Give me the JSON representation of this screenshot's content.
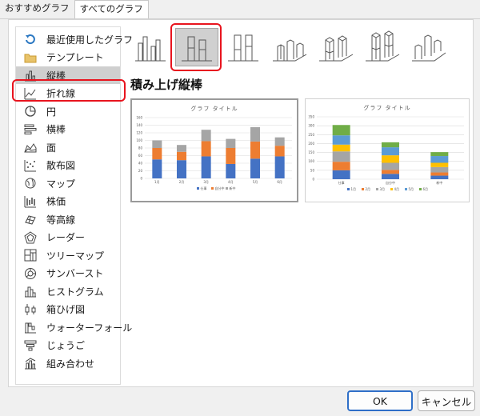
{
  "tabs": [
    {
      "label": "おすすめグラフ",
      "active": false
    },
    {
      "label": "すべてのグラフ",
      "active": true
    }
  ],
  "sidebar": {
    "selected_index": 2,
    "items": [
      {
        "label": "最近使用したグラフ",
        "icon": "recent-icon"
      },
      {
        "label": "テンプレート",
        "icon": "folder-icon"
      },
      {
        "label": "縦棒",
        "icon": "column-chart-icon"
      },
      {
        "label": "折れ線",
        "icon": "line-chart-icon"
      },
      {
        "label": "円",
        "icon": "pie-chart-icon"
      },
      {
        "label": "横棒",
        "icon": "bar-chart-icon"
      },
      {
        "label": "面",
        "icon": "area-chart-icon"
      },
      {
        "label": "散布図",
        "icon": "scatter-chart-icon"
      },
      {
        "label": "マップ",
        "icon": "map-chart-icon"
      },
      {
        "label": "株価",
        "icon": "stock-chart-icon"
      },
      {
        "label": "等高線",
        "icon": "surface-chart-icon"
      },
      {
        "label": "レーダー",
        "icon": "radar-chart-icon"
      },
      {
        "label": "ツリーマップ",
        "icon": "treemap-chart-icon"
      },
      {
        "label": "サンバースト",
        "icon": "sunburst-chart-icon"
      },
      {
        "label": "ヒストグラム",
        "icon": "histogram-chart-icon"
      },
      {
        "label": "箱ひげ図",
        "icon": "boxplot-chart-icon"
      },
      {
        "label": "ウォーターフォール",
        "icon": "waterfall-chart-icon"
      },
      {
        "label": "じょうご",
        "icon": "funnel-chart-icon"
      },
      {
        "label": "組み合わせ",
        "icon": "combo-chart-icon"
      }
    ]
  },
  "chart_types": {
    "selected_index": 1,
    "items": [
      {
        "icon": "clustered-column-icon"
      },
      {
        "icon": "stacked-column-icon"
      },
      {
        "icon": "100-stacked-column-icon"
      },
      {
        "icon": "3d-clustered-column-icon"
      },
      {
        "icon": "3d-stacked-column-icon"
      },
      {
        "icon": "3d-100-stacked-column-icon"
      },
      {
        "icon": "3d-column-icon"
      }
    ]
  },
  "selected_chart_name": "積み上げ縦棒",
  "colors": {
    "series1": "#4472c4",
    "series2": "#ed7d31",
    "series3": "#a5a5a5",
    "series4": "#ffc000",
    "series5": "#5b9bd5",
    "series6": "#70ad47",
    "highlight": "#e8141e",
    "accent": "#2f6fc8"
  },
  "previews": [
    {
      "title": "グラフ タイトル",
      "chart_data": {
        "type": "bar",
        "stacked": true,
        "categories": [
          "1月",
          "2月",
          "3月",
          "4月",
          "5月",
          "6月"
        ],
        "series": [
          {
            "name": "仕事",
            "values": [
              50,
              48,
              58,
              38,
              52,
              58
            ]
          },
          {
            "name": "自分中",
            "values": [
              30,
              22,
              40,
              42,
              45,
              28
            ]
          },
          {
            "name": "新中",
            "values": [
              20,
              18,
              30,
              24,
              38,
              22
            ]
          }
        ],
        "yticks": [
          "0",
          "20",
          "40",
          "60",
          "80",
          "100",
          "120",
          "140",
          "160"
        ],
        "ylim": [
          0,
          160
        ],
        "legend": "bottom"
      }
    },
    {
      "title": "グラフ タイトル",
      "chart_data": {
        "type": "bar",
        "stacked": true,
        "categories": [
          "仕事",
          "自分中",
          "新中"
        ],
        "series": [
          {
            "name": "1月",
            "values": [
              50,
              30,
              20
            ]
          },
          {
            "name": "2月",
            "values": [
              48,
              22,
              18
            ]
          },
          {
            "name": "3月",
            "values": [
              58,
              40,
              30
            ]
          },
          {
            "name": "4月",
            "values": [
              38,
              42,
              24
            ]
          },
          {
            "name": "5月",
            "values": [
              52,
              45,
              38
            ]
          },
          {
            "name": "6月",
            "values": [
              58,
              28,
              22
            ]
          }
        ],
        "yticks": [
          "0",
          "50",
          "100",
          "150",
          "200",
          "250",
          "300",
          "350"
        ],
        "ylim": [
          0,
          350
        ],
        "legend": "bottom"
      }
    }
  ],
  "buttons": {
    "ok": "OK",
    "cancel": "キャンセル"
  }
}
